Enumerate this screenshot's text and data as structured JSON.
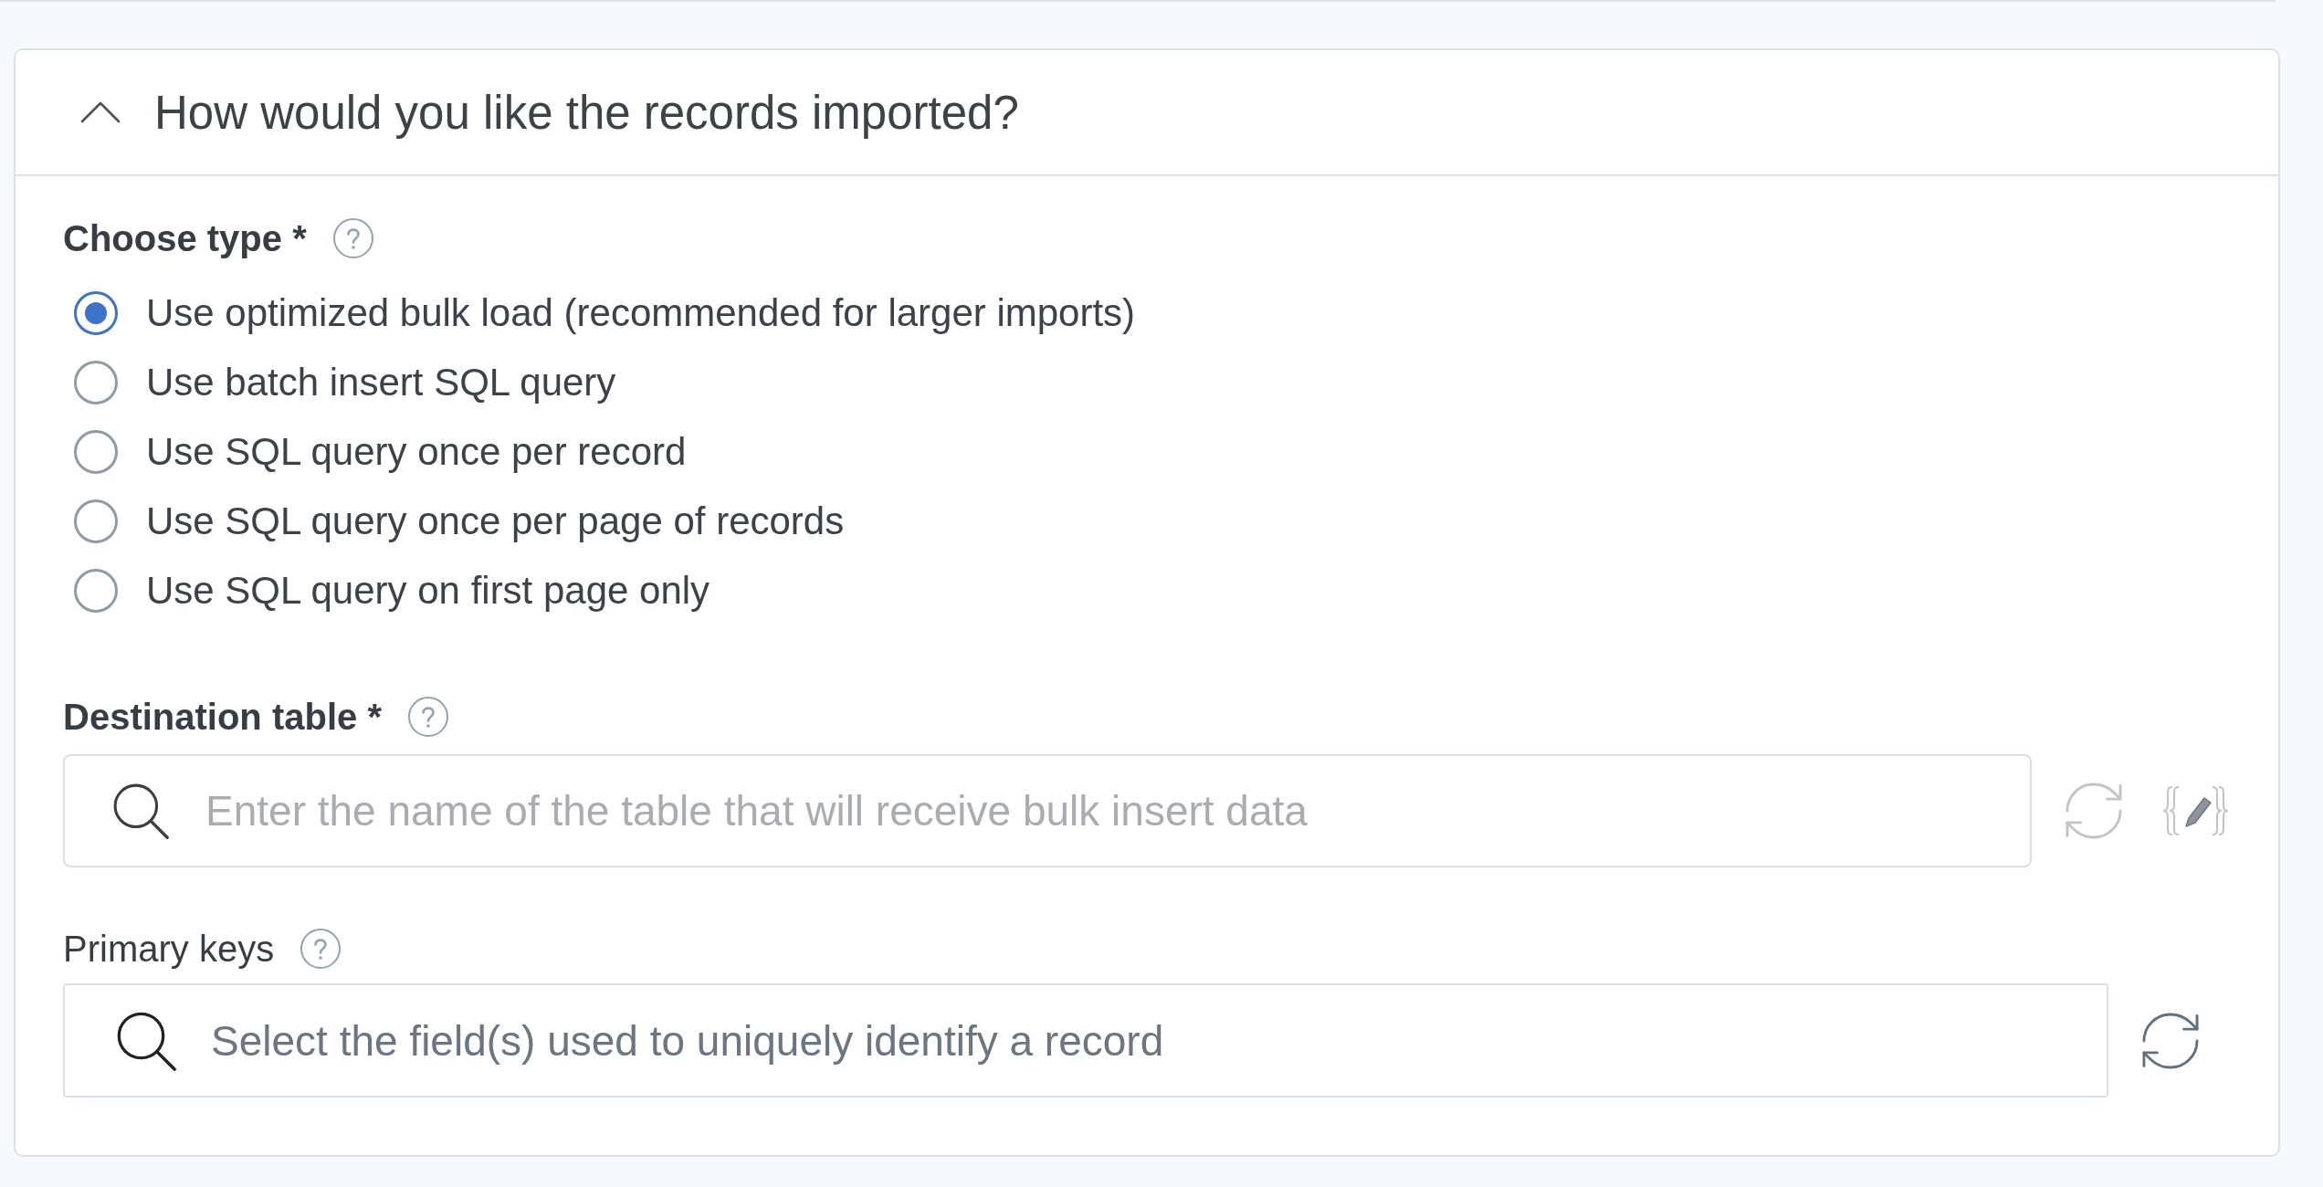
{
  "section": {
    "title": "How would you like the records imported?",
    "expanded": true
  },
  "choose_type": {
    "label": "Choose type *",
    "required": true,
    "options": [
      {
        "label": "Use optimized bulk load (recommended for larger imports)",
        "selected": true
      },
      {
        "label": "Use batch insert SQL query",
        "selected": false
      },
      {
        "label": "Use SQL query once per record",
        "selected": false
      },
      {
        "label": "Use SQL query once per page of records",
        "selected": false
      },
      {
        "label": "Use SQL query on first page only",
        "selected": false
      }
    ]
  },
  "destination_table": {
    "label": "Destination table *",
    "required": true,
    "placeholder": "Enter the name of the table that will receive bulk insert data",
    "disabled": true,
    "actions": [
      {
        "kind": "refresh"
      },
      {
        "kind": "variable"
      }
    ]
  },
  "primary_keys": {
    "label": "Primary keys",
    "required": false,
    "placeholder": "Select the field(s) used to uniquely identify a record",
    "disabled": false,
    "actions": [
      {
        "kind": "refresh"
      }
    ]
  }
}
